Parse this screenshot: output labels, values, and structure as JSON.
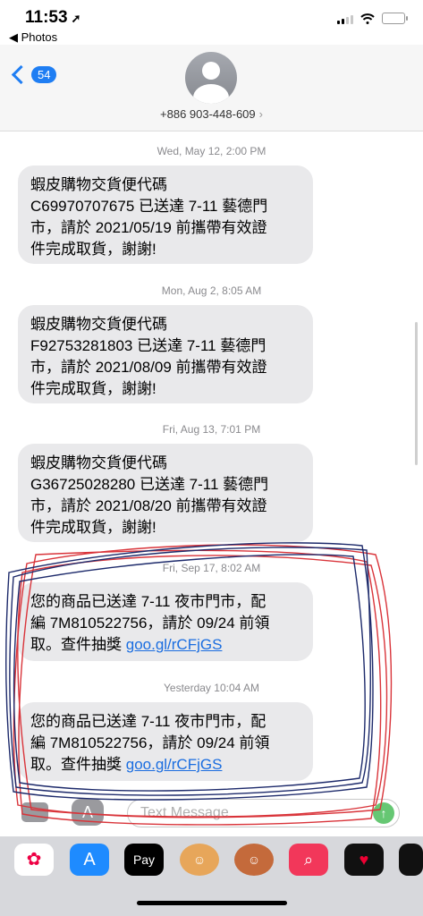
{
  "status": {
    "time": "11:53",
    "back_app": "◀ Photos"
  },
  "header": {
    "unread_count": "54",
    "contact": "+886 903-448-609"
  },
  "messages": [
    {
      "timestamp_day": "Wed, May 12,",
      "timestamp_time": "2:00 PM",
      "text": "蝦皮購物交貨便代碼\nC69970707675 已送達 7-11 藝德門\n市，請於 2021/05/19 前攜帶有效證\n件完成取貨，謝謝!"
    },
    {
      "timestamp_day": "Mon, Aug 2,",
      "timestamp_time": "8:05 AM",
      "text": "蝦皮購物交貨便代碼\nF92753281803 已送達 7-11 藝德門\n市，請於 2021/08/09 前攜帶有效證\n件完成取貨，謝謝!"
    },
    {
      "timestamp_day": "Fri, Aug 13,",
      "timestamp_time": "7:01 PM",
      "text": "蝦皮購物交貨便代碼\nG36725028280 已送達 7-11 藝德門\n市，請於 2021/08/20 前攜帶有效證\n件完成取貨，謝謝!"
    },
    {
      "timestamp_day": "Fri, Sep 17,",
      "timestamp_time": "8:02 AM",
      "text": "您的商品已送達 7-11 夜市門市，配\n編 7M810522756，請於 09/24 前領\n取。查件抽獎 ",
      "link": "goo.gl/rCFjGS"
    },
    {
      "timestamp_day": "Yesterday",
      "timestamp_time": "10:04 AM",
      "text": "您的商品已送達 7-11 夜市門市，配\n編 7M810522756，請於 09/24 前領\n取。查件抽獎 ",
      "link": "goo.gl/rCFjGS"
    }
  ],
  "input": {
    "placeholder": "Text Message"
  },
  "dock": {
    "apple_pay_label": "Pay"
  },
  "colors": {
    "accent": "#1f7ef3",
    "bubble": "#e9e9eb",
    "link": "#1a6de0",
    "scribble_red": "#d9343a",
    "scribble_blue": "#1d2a6b"
  },
  "icons": [
    "location-arrow-icon",
    "signal-icon",
    "wifi-icon",
    "battery-icon",
    "back-chevron-icon",
    "contact-avatar-icon",
    "camera-icon",
    "app-store-icon",
    "send-arrow-icon",
    "photos-app-icon",
    "app-store-app-icon",
    "apple-pay-app-icon",
    "memoji-app-icon",
    "memoji-app-icon-2",
    "search-app-icon",
    "heart-app-icon"
  ]
}
